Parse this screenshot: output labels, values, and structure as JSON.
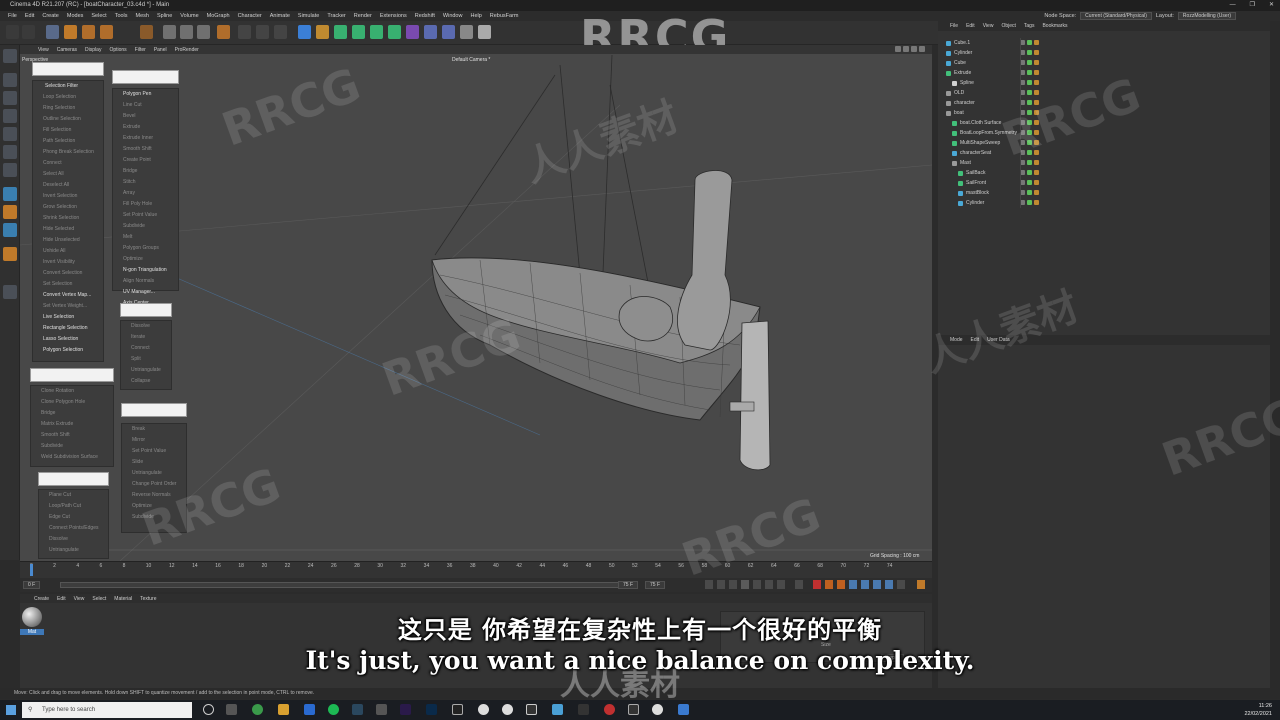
{
  "app": {
    "title": "Cinema 4D R21.207 (RC) - [boatCharacter_03.c4d *] - Main",
    "window_buttons": [
      "—",
      "❐",
      "✕"
    ]
  },
  "menu": [
    "File",
    "Edit",
    "Create",
    "Modes",
    "Select",
    "Tools",
    "Mesh",
    "Spline",
    "Volume",
    "MoGraph",
    "Character",
    "Animate",
    "Simulate",
    "Tracker",
    "Render",
    "Extensions",
    "Redshift",
    "Window",
    "Help",
    "RebusFarm"
  ],
  "node_space": {
    "label": "Node Space:",
    "value": "Current (Standard/Physical)"
  },
  "layout": {
    "label": "Layout:",
    "value": "RozzModelling (User)"
  },
  "viewport": {
    "menu": [
      "View",
      "Cameras",
      "Display",
      "Options",
      "Filter",
      "Panel",
      "ProRender"
    ],
    "view_name": "Perspective",
    "camera": "Default Camera *",
    "grid_spacing": "Grid Spacing : 100 cm"
  },
  "selection_panel": {
    "title": "Selection Filter",
    "items": [
      "Loop Selection",
      "Ring Selection",
      "Outline Selection",
      "Fill Selection",
      "Path Selection",
      "Phong Break Selection",
      "Connect",
      "Select All",
      "Deselect All",
      "Invert Selection",
      "Grow Selection",
      "Shrink Selection",
      "Hide Selected",
      "Hide Unselected",
      "Unhide All",
      "Invert Visibility",
      "Convert Selection",
      "Set Selection",
      "Convert Vertex Map...",
      "Set Vertex Weight...",
      "Live Selection",
      "Rectangle Selection",
      "Lasso Selection",
      "Polygon Selection"
    ],
    "lit": [
      0,
      18,
      20,
      21,
      22,
      23
    ]
  },
  "mesh_panel": {
    "items": [
      "Polygon Pen",
      "Line Cut",
      "Bevel",
      "Extrude",
      "Extrude Inner",
      "Smooth Shift",
      "Create Point",
      "Bridge",
      "Stitch",
      "Array",
      "Fill Poly Hole",
      "Set Point Value",
      "Subdivide",
      "Melt",
      "Polygon Groups",
      "Optimize",
      "N-gon Triangulation",
      "Align Normals",
      "UV Manager...",
      "Axis Center..."
    ],
    "lit": [
      0,
      16,
      18,
      19
    ]
  },
  "panel3": {
    "items": [
      "Dissolve",
      "Iterate",
      "Connect",
      "Split",
      "Untriangulate",
      "Collapse"
    ]
  },
  "panel4": {
    "items": [
      "Clone Rotation",
      "Clone Polygon Hole",
      "Bridge",
      "Matrix Extrude",
      "Smooth Shift",
      "Subdivide",
      "Weld Subdivision Surface"
    ]
  },
  "panel5": {
    "items": [
      "Break",
      "Mirror",
      "Set Point Value",
      "Slide",
      "Untriangulate",
      "Change Point Order",
      "Reverse Normals",
      "Optimize",
      "Subdivide"
    ]
  },
  "panel6": {
    "items": [
      "Plane Cut",
      "Loop/Path Cut",
      "Edge Cut",
      "Connect Points/Edges",
      "Dissolve",
      "Untriangulate"
    ]
  },
  "objects": {
    "menu": [
      "File",
      "Edit",
      "View",
      "Object",
      "Tags",
      "Bookmarks"
    ],
    "rows": [
      {
        "name": "Cube.1",
        "indent": 0,
        "color": "#4aa9d6"
      },
      {
        "name": "Cylinder",
        "indent": 0,
        "color": "#4aa9d6"
      },
      {
        "name": "Cube",
        "indent": 0,
        "color": "#4aa9d6"
      },
      {
        "name": "Extrude",
        "indent": 0,
        "color": "#42c07a"
      },
      {
        "name": "Spline",
        "indent": 1,
        "color": "#d0d0d0"
      },
      {
        "name": "OLD",
        "indent": 0,
        "color": "#9a9a9a"
      },
      {
        "name": "character",
        "indent": 0,
        "color": "#9a9a9a"
      },
      {
        "name": "boat",
        "indent": 0,
        "color": "#9a9a9a"
      },
      {
        "name": "boat.Cloth Surface",
        "indent": 1,
        "color": "#42c07a"
      },
      {
        "name": "BoatLoopFrom.Symmetry",
        "indent": 1,
        "color": "#42c07a"
      },
      {
        "name": "MultiShapeSweep",
        "indent": 1,
        "color": "#42c07a"
      },
      {
        "name": "characterSeat",
        "indent": 1,
        "color": "#4aa9d6"
      },
      {
        "name": "Mast",
        "indent": 1,
        "color": "#9a9a9a"
      },
      {
        "name": "SailBack",
        "indent": 2,
        "color": "#42c07a"
      },
      {
        "name": "SailFront",
        "indent": 2,
        "color": "#42c07a"
      },
      {
        "name": "mastBlock",
        "indent": 2,
        "color": "#4aa9d6"
      },
      {
        "name": "Cylinder",
        "indent": 2,
        "color": "#4aa9d6"
      }
    ]
  },
  "attributes": {
    "menu": [
      "Mode",
      "Edit",
      "User Data"
    ]
  },
  "timeline": {
    "ticks": [
      "0",
      "2",
      "4",
      "6",
      "8",
      "10",
      "12",
      "14",
      "16",
      "18",
      "20",
      "22",
      "24",
      "26",
      "28",
      "30",
      "32",
      "34",
      "36",
      "38",
      "40",
      "42",
      "44",
      "46",
      "48",
      "50",
      "52",
      "54",
      "56",
      "58",
      "60",
      "62",
      "64",
      "66",
      "68",
      "70",
      "72",
      "74"
    ],
    "current": "0 F",
    "end_a": "75 F",
    "end_b": "75 F",
    "frame_right": "0 F"
  },
  "material": {
    "menu": [
      "Create",
      "Edit",
      "View",
      "Select",
      "Material",
      "Texture"
    ],
    "mat_label": "Mat"
  },
  "attr_fields": {
    "scale_label": "Size",
    "apply": "Apply"
  },
  "status": "Move: Click and drag to move elements. Hold down SHIFT to quantize movement / add to the selection in point mode, CTRL to remove.",
  "taskbar": {
    "search_placeholder": "Type here to search",
    "time": "11:26",
    "date": "22/02/2021"
  },
  "subtitles": {
    "cn": "这只是 你希望在复杂性上有一个很好的平衡",
    "en": "It's just, you want a nice balance on complexity."
  },
  "watermarks": {
    "main": "RRCG",
    "cn": "人人素材"
  }
}
